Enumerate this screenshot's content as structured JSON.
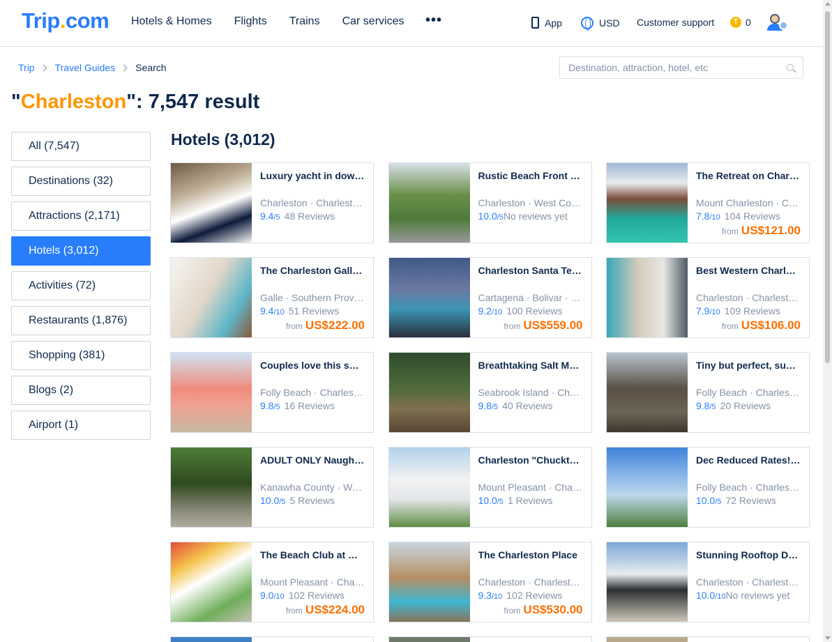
{
  "header": {
    "logo_main": "Trip",
    "logo_dot": ".",
    "logo_end": "com",
    "nav": [
      "Hotels & Homes",
      "Flights",
      "Trains",
      "Car services"
    ],
    "more": "•••",
    "app_label": "App",
    "currency": "USD",
    "support": "Customer support",
    "coin_symbol": "T",
    "coins": "0"
  },
  "breadcrumb": {
    "items": [
      "Trip",
      "Travel Guides"
    ],
    "current": "Search"
  },
  "search": {
    "placeholder": "Destination, attraction, hotel, etc"
  },
  "title": {
    "open_quote": "\"",
    "keyword": "Charleston",
    "rest": "\": 7,547 result"
  },
  "sidebar": {
    "items": [
      {
        "label": "All (7,547)",
        "active": false
      },
      {
        "label": "Destinations (32)",
        "active": false
      },
      {
        "label": "Attractions (2,171)",
        "active": false
      },
      {
        "label": "Hotels (3,012)",
        "active": true
      },
      {
        "label": "Activities (72)",
        "active": false
      },
      {
        "label": "Restaurants (1,876)",
        "active": false
      },
      {
        "label": "Shopping (381)",
        "active": false
      },
      {
        "label": "Blogs (2)",
        "active": false
      },
      {
        "label": "Airport (1)",
        "active": false
      }
    ]
  },
  "section": {
    "title": "Hotels (3,012)"
  },
  "hotels": [
    {
      "name": "Luxury yacht in downtown Charleston",
      "location": "Charleston · Charleston County",
      "score": "9.4",
      "outof": "/5",
      "reviews": "48 Reviews",
      "from": "",
      "price": ""
    },
    {
      "name": "Rustic Beach Front Cottage",
      "location": "Charleston · West Coast",
      "score": "10.0",
      "outof": "/5",
      "reviews": "No reviews yet",
      "from": "",
      "price": ""
    },
    {
      "name": "The Retreat on Charleston Peak",
      "location": "Mount Charleston · Clark County",
      "score": "7.8",
      "outof": "/10",
      "reviews": "104 Reviews",
      "from": "from",
      "price": "US$121.00"
    },
    {
      "name": "The Charleston Galle Fort",
      "location": "Galle · Southern Province",
      "score": "9.4",
      "outof": "/10",
      "reviews": "51 Reviews",
      "from": "from",
      "price": "US$222.00"
    },
    {
      "name": "Charleston Santa Teresa",
      "location": "Cartagena · Bolivar · Colombia",
      "score": "9.2",
      "outof": "/10",
      "reviews": "100 Reviews",
      "from": "from",
      "price": "US$559.00"
    },
    {
      "name": "Best Western Charleston Inn",
      "location": "Charleston · Charleston County",
      "score": "7.9",
      "outof": "/10",
      "reviews": "109 Reviews",
      "from": "from",
      "price": "US$106.00"
    },
    {
      "name": "Couples love this sweet cottage",
      "location": "Folly Beach · Charleston County",
      "score": "9.8",
      "outof": "/5",
      "reviews": "16 Reviews",
      "from": "",
      "price": ""
    },
    {
      "name": "Breathtaking Salt Marsh Views",
      "location": "Seabrook Island · Charleston",
      "score": "9.8",
      "outof": "/5",
      "reviews": "40 Reviews",
      "from": "",
      "price": ""
    },
    {
      "name": "Tiny but perfect, sunny studio",
      "location": "Folly Beach · Charleston County",
      "score": "9.8",
      "outof": "/5",
      "reviews": "20 Reviews",
      "from": "",
      "price": ""
    },
    {
      "name": "ADULT ONLY Naughty Cabin",
      "location": "Kanawha County · West Virginia",
      "score": "10.0",
      "outof": "/5",
      "reviews": "5 Reviews",
      "from": "",
      "price": ""
    },
    {
      "name": "Charleston \"Chuckt\" Cottage",
      "location": "Mount Pleasant · Charleston",
      "score": "10.0",
      "outof": "/5",
      "reviews": "1 Reviews",
      "from": "",
      "price": ""
    },
    {
      "name": "Dec Reduced Rates! Beach House",
      "location": "Folly Beach · Charleston County",
      "score": "10.0",
      "outof": "/5",
      "reviews": "72 Reviews",
      "from": "",
      "price": ""
    },
    {
      "name": "The Beach Club at Charleston Harbor",
      "location": "Mount Pleasant · Charleston",
      "score": "9.0",
      "outof": "/10",
      "reviews": "102 Reviews",
      "from": "from",
      "price": "US$224.00"
    },
    {
      "name": "The Charleston Place",
      "location": "Charleston · Charleston County",
      "score": "9.3",
      "outof": "/10",
      "reviews": "102 Reviews",
      "from": "from",
      "price": "US$530.00"
    },
    {
      "name": "Stunning Rooftop Deck Home",
      "location": "Charleston · Charleston County",
      "score": "10.0",
      "outof": "/10",
      "reviews": "No reviews yet",
      "from": "",
      "price": ""
    }
  ],
  "colors": {
    "brand": "#287dfa",
    "accent_orange": "#ff9500",
    "price": "#ff6f00",
    "text": "#0f294d",
    "muted": "#8592a6"
  }
}
